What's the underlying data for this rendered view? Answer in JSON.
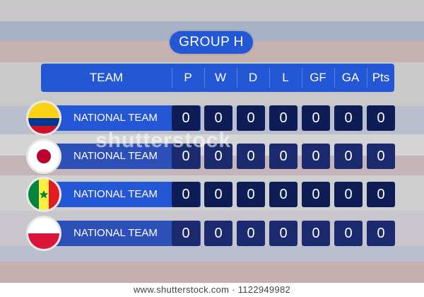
{
  "title": "GROUP H",
  "columns": [
    "TEAM",
    "P",
    "W",
    "D",
    "L",
    "GF",
    "GA",
    "Pts"
  ],
  "teams": [
    {
      "name": "NATIONAL TEAM",
      "flag": "colombia-flag-icon",
      "stats": [
        "0",
        "0",
        "0",
        "0",
        "0",
        "0",
        "0"
      ]
    },
    {
      "name": "NATIONAL TEAM",
      "flag": "japan-flag-icon",
      "stats": [
        "0",
        "0",
        "0",
        "0",
        "0",
        "0",
        "0"
      ]
    },
    {
      "name": "NATIONAL TEAM",
      "flag": "senegal-flag-icon",
      "stats": [
        "0",
        "0",
        "0",
        "0",
        "0",
        "0",
        "0"
      ]
    },
    {
      "name": "NATIONAL TEAM",
      "flag": "poland-flag-icon",
      "stats": [
        "0",
        "0",
        "0",
        "0",
        "0",
        "0",
        "0"
      ]
    }
  ],
  "watermark": "shutterstock",
  "footer": "www.shutterstock.com · 1122949982",
  "colors": {
    "accent": "#2457d6",
    "stat_bg": "#0f1d56"
  }
}
